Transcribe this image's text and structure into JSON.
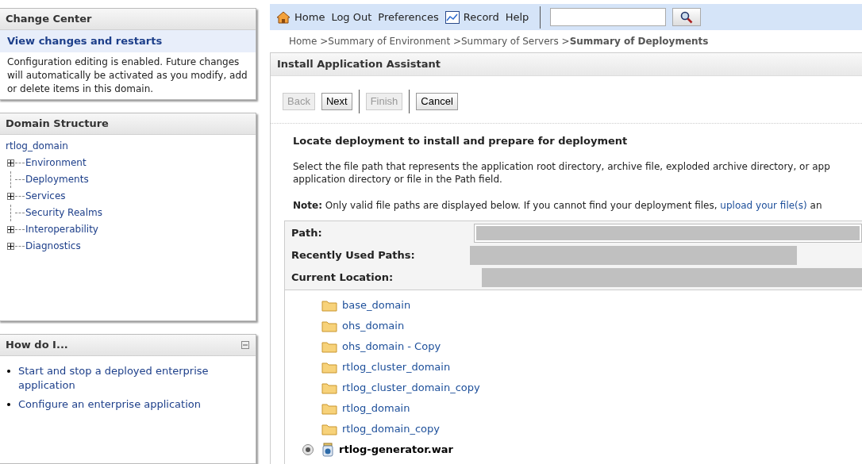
{
  "change_center": {
    "title": "Change Center",
    "link": "View changes and restarts",
    "message": "Configuration editing is enabled. Future changes will automatically be activated as you modify, add or delete items in this domain."
  },
  "domain_structure": {
    "title": "Domain Structure",
    "root": "rtlog_domain",
    "items": [
      {
        "label": "Environment",
        "expandable": true
      },
      {
        "label": "Deployments",
        "expandable": false
      },
      {
        "label": "Services",
        "expandable": true
      },
      {
        "label": "Security Realms",
        "expandable": false
      },
      {
        "label": "Interoperability",
        "expandable": true
      },
      {
        "label": "Diagnostics",
        "expandable": true
      }
    ]
  },
  "how_do_i": {
    "title": "How do I...",
    "expanded": true,
    "links": [
      "Start and stop a deployed enterprise application",
      "Configure an enterprise application"
    ]
  },
  "toolbar": {
    "links": [
      {
        "label": "Home",
        "kind": "home"
      },
      {
        "label": "Log Out",
        "kind": "plain"
      },
      {
        "label": "Preferences",
        "kind": "plain"
      },
      {
        "label": "Record",
        "kind": "record"
      },
      {
        "label": "Help",
        "kind": "plain"
      }
    ]
  },
  "breadcrumb": {
    "links": [
      "Home >",
      "Summary of Environment >",
      "Summary of Servers >"
    ],
    "current": "Summary of Deployments"
  },
  "assistant": {
    "title": "Install Application Assistant",
    "buttons": [
      {
        "label": "Back",
        "disabled": true
      },
      {
        "label": "Next",
        "disabled": false
      },
      {
        "label": "Finish",
        "disabled": true
      },
      {
        "label": "Cancel",
        "disabled": false
      }
    ],
    "heading": "Locate deployment to install and prepare for deployment",
    "description": [
      "Select the file path that represents the application root directory, archive file, exploded archive directory, or app",
      "application directory or file in the Path field."
    ],
    "note": "**Note:** Only valid file paths are displayed below. If you cannot find your deployment files, ",
    "note_link": "upload your file(s)",
    "note_tail": " an",
    "fields": [
      {
        "label": "Path:",
        "kind": "input"
      },
      {
        "label": "Recently Used Paths:",
        "kind": "text"
      },
      {
        "label": "Current Location:",
        "kind": "text"
      }
    ],
    "files": [
      {
        "name": "base_domain",
        "kind": "folder"
      },
      {
        "name": "ohs_domain",
        "kind": "folder"
      },
      {
        "name": "ohs_domain - Copy",
        "kind": "folder"
      },
      {
        "name": "rtlog_cluster_domain",
        "kind": "folder"
      },
      {
        "name": "rtlog_cluster_domain_copy",
        "kind": "folder"
      },
      {
        "name": "rtlog_domain",
        "kind": "folder"
      },
      {
        "name": "rtlog_domain_copy",
        "kind": "folder"
      },
      {
        "name": "rtlog-generator.war",
        "kind": "archive",
        "selected": true
      }
    ]
  }
}
